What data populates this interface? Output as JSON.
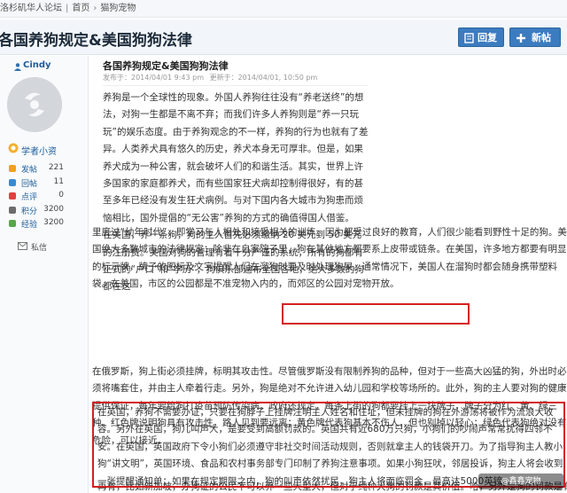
{
  "breadcrumb": {
    "site": "洛杉矶华人论坛",
    "home": "首页",
    "section": "猫狗宠物"
  },
  "header": {
    "title": "各国养狗规定&美国狗狗法律",
    "reply_label": "回复",
    "new_label": "新帖"
  },
  "colors": {
    "accent": "#3b7bbf",
    "link": "#1d5c9a",
    "highlight_border": "#d42020"
  },
  "user": {
    "name": "Cindy",
    "rank": "学者小资",
    "stats": [
      {
        "label": "发帖",
        "value": "221",
        "icon": "post-icon",
        "color": "#f0a020"
      },
      {
        "label": "回帖",
        "value": "11",
        "icon": "reply-icon",
        "color": "#3a8ad0"
      },
      {
        "label": "点评",
        "value": "0",
        "icon": "comment-icon",
        "color": "#e04040"
      },
      {
        "label": "积分",
        "value": "3200",
        "icon": "points-icon",
        "color": "#6c6c6c"
      },
      {
        "label": "经验",
        "value": "3200",
        "icon": "exp-icon",
        "color": "#58a64a"
      }
    ],
    "pm_label": "私信"
  },
  "post": {
    "title": "各国养狗规定&美国狗狗法律",
    "posted_label": "发布于：2014/04/01  9:43 pm",
    "updated_label": "更新于：2014/04/01, 10:50 pm",
    "narrow_paragraphs": [
      "养狗是一个全球性的现象。外国人养狗往往没有“养老送终”的想法，对狗一生都是不离不弃；而我们许多人养狗则是“养一只玩玩”的娱乐态度。由于养狗观念的不一样，养狗的行为也就有了差异。人类养犬具有悠久的历史，养犬本身无可厚非。但是，如果养犬成为一种公害，就会破坏人们的和谐生活。其实，世界上许多国家的家庭都养犬，而有些国家狂犬病却控制得很好，有的甚至多年已经没有发生狂犬病例。与对下国内各大城市为狗患而烦恼相比，国外提倡的“无公害”养狗的方式的确值得国人借鉴。",
      "在美国，养一条狗，狗的主人首先必须缴纳 20 美元到 50 美元的注册费。美国对狗的管理有着十分严谨的系统，所有的狗都有正式的“户口”和“学历”，狗俱乐部遍布全国各地，绝大多数的狗都在这"
    ],
    "wide_para_1": "里度过“幼年时代”，即学习与人相处和接受相关的训练。因为都受过良好的教育，人们很少能看到野性十足的狗。美国绝大多数城市的法律规定：除非在自家院子里，狗在其他地方都要系上皮带或链条。在美国，许多地方都要有明显的标示牌，牌子的图标及文字提醒人们在溜狗时要及时处理狗屎。通常情况下，美国人在溜狗时都会随身携带塑料袋。在美国，市区的公园都是不准宠物入内的，而郊区的公园对宠物开放。",
    "highlight_text": "通常情况下，美国人在溜狗时都会随身携带塑料袋。",
    "wide_para_2": "在俄罗斯，狗上街必须挂牌，标明其攻击性。尽管俄罗斯没有限制养狗的品种，但对于一些高大凶猛的狗，外出时必须将嘴套住，并由主人牵着行走。另外，狗是绝对不允许进入幼儿园和学校等场所的。此外，狗的主人要对狗的健康提供保证，每年要给狗打疫苗预防传染病。政府还规定，每条上街的狗都要挂上一块牌子，牌子分为红、黄、绿三种。红色牌说明狗具有攻击性，路人见到要远离；黄色牌代表狗基本不伤人，但也别掉以轻心；绿色代表狗绝对没有危险，可以接近。",
    "wide_para_3": "在英国，养狗不需要办证，只要在狗脖子上挂牌注明主人姓名和住址，但未挂牌的狗在外游荡将被作为流浪犬收容。另外在英国，狗儿叫声大，是要受到高额罚款的。英国共有近680万只狗，小狗们的吵闹声常常扰得四邻不安。在英国，英国政府下令小狗们必须遵守非社交时间活动规则，否则就拿主人的钱袋开刀。为了指导狗主人教小狗“讲文明”，英国环境、食品和农村事务部专门印制了养狗注意事项。如果小狗狂吠，邻居投诉，狗主人将会收到一张提醒通知单；如果在规定期限之内，狗的叫声依然扰民，狗主人将面临罚金，最高达5000英镑。",
    "bottom_line": "再有，比如新加坡，办狗证的公民不可以养一些大型犬，但对于纯种犬狗的罚款是其价值。哈，另外是狗的罚款是有效与主人看守，还有，在开车"
  },
  "watermark": "@鑫鑫宠物"
}
